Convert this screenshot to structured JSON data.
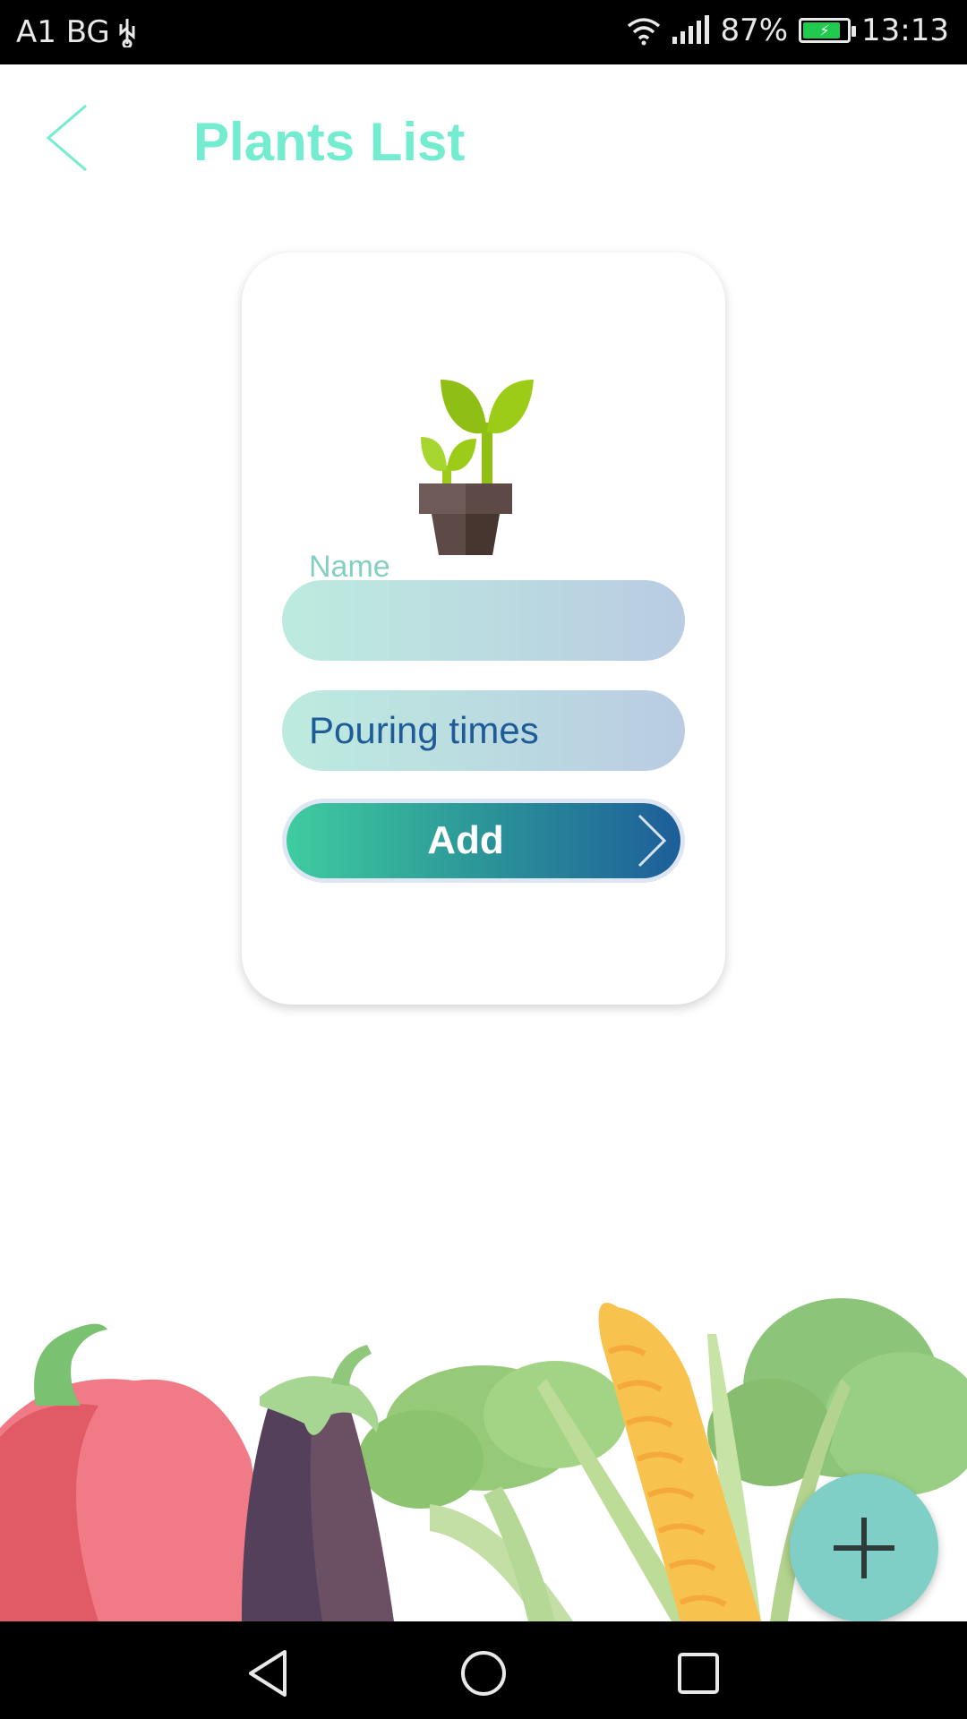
{
  "status_bar": {
    "carrier": "A1 BG",
    "usb_icon": "usb-icon",
    "wifi_icon": "wifi-icon",
    "signal_icon": "signal-icon",
    "battery_percent": "87%",
    "battery_level": 0.87,
    "time": "13:13"
  },
  "header": {
    "back_icon": "chevron-left-icon",
    "title": "Plants List"
  },
  "form": {
    "plant_icon": "potted-plant-icon",
    "name_label": "Name",
    "name_value": "",
    "pouring_placeholder": "Pouring times",
    "add_label": "Add",
    "add_icon": "chevron-right-icon"
  },
  "fab": {
    "icon": "plus-icon"
  },
  "nav": {
    "back_icon": "triangle-back-icon",
    "home_icon": "circle-home-icon",
    "recents_icon": "square-recents-icon"
  },
  "colors": {
    "accent": "#74ecd0",
    "input_text": "#1f5b98",
    "fab": "#7fcfc6",
    "button_start": "#3fcca0",
    "button_end": "#1d5e9a"
  }
}
